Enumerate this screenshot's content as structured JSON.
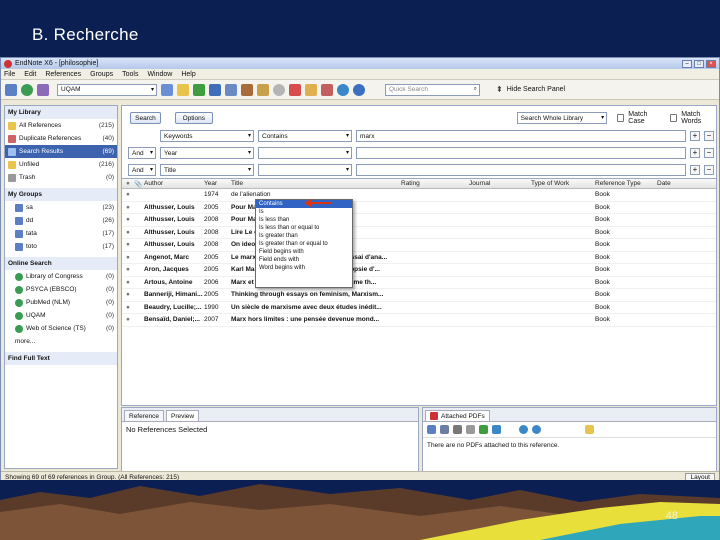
{
  "slide": {
    "title": "B.  Recherche",
    "page_number": "48"
  },
  "app": {
    "window_title": "EndNote X6 - [philosophie]",
    "menu": [
      "File",
      "Edit",
      "References",
      "Groups",
      "Tools",
      "Window",
      "Help"
    ],
    "toolbar": {
      "library_select": "UQAM",
      "quick_search_placeholder": "Quick Search",
      "hide_search_panel": "Hide Search Panel"
    }
  },
  "sidebar": {
    "my_library": "My Library",
    "items": [
      {
        "label": "All References",
        "count": "(215)"
      },
      {
        "label": "Duplicate References",
        "count": "(40)"
      },
      {
        "label": "Search Results",
        "count": "(69)"
      },
      {
        "label": "Unfiled",
        "count": "(216)"
      },
      {
        "label": "Trash",
        "count": "(0)"
      }
    ],
    "my_groups": "My Groups",
    "groups": [
      {
        "label": "sa",
        "count": "(23)"
      },
      {
        "label": "dd",
        "count": "(26)"
      },
      {
        "label": "tata",
        "count": "(17)"
      },
      {
        "label": "toto",
        "count": "(17)"
      }
    ],
    "online_search": "Online Search",
    "online": [
      {
        "label": "Library of Congress",
        "count": "(0)"
      },
      {
        "label": "PSYCA (EBSCO)",
        "count": "(0)"
      },
      {
        "label": "PubMed (NLM)",
        "count": "(0)"
      },
      {
        "label": "UQAM",
        "count": "(0)"
      },
      {
        "label": "Web of Science (TS)",
        "count": "(0)"
      }
    ],
    "more": "more...",
    "find_full_text": "Find Full Text"
  },
  "search": {
    "search_button": "Search",
    "options_button": "Options",
    "search_scope": "Search Whole Library",
    "match_case": "Match Case",
    "match_words": "Match Words",
    "rows": [
      {
        "bool": "",
        "field": "Keywords",
        "op": "Contains",
        "value": "marx"
      },
      {
        "bool": "And",
        "field": "Year",
        "op": "",
        "value": ""
      },
      {
        "bool": "And",
        "field": "Title",
        "op": "",
        "value": ""
      }
    ],
    "operators": [
      "Contains",
      "Is",
      "Is less than",
      "Is less than or equal to",
      "Is greater than",
      "Is greater than or equal to",
      "Field begins with",
      "Field ends with",
      "Word begins with"
    ]
  },
  "table": {
    "headers": [
      "Author",
      "Year",
      "Title",
      "Rating",
      "Journal",
      "Type of Work",
      "Reference Type",
      "Date"
    ],
    "rows": [
      {
        "author": "",
        "year": "1974",
        "title": "de l'alienation",
        "rt": "Book"
      },
      {
        "author": "Althusser, Louis",
        "year": "2005",
        "title": "Pour Marx",
        "rt": "Book"
      },
      {
        "author": "Althusser, Louis",
        "year": "2008",
        "title": "Pour Marx",
        "rt": "Book"
      },
      {
        "author": "Althusser, Louis",
        "year": "2008",
        "title": "Lire Le capital",
        "rt": "Book"
      },
      {
        "author": "Althusser, Louis",
        "year": "2008",
        "title": "On ideology",
        "rt": "Book"
      },
      {
        "author": "Angenot, Marc",
        "year": "2005",
        "title": "Le marxisme dans les grands récits : essai d'ana...",
        "rt": "Book"
      },
      {
        "author": "Aron, Jacques",
        "year": "2005",
        "title": "Karl Marx, antisémite et criminel? : autopsie d'...",
        "rt": "Book"
      },
      {
        "author": "Artous, Antoine",
        "year": "2006",
        "title": "Marx et le fétichisme : le marxisme comme th...",
        "rt": "Book"
      },
      {
        "author": "Banneriji, Himani...",
        "year": "2005",
        "title": "Thinking through essays on feminism, Marxism...",
        "rt": "Book"
      },
      {
        "author": "Beaudry, Lucille;...",
        "year": "1990",
        "title": "Un siècle de marxisme avec deux études inédit...",
        "rt": "Book"
      },
      {
        "author": "Bensaïd, Daniel;...",
        "year": "2007",
        "title": "Marx hors limites : une pensée devenue mond...",
        "rt": "Book"
      }
    ]
  },
  "preview": {
    "tab_reference": "Reference",
    "tab_preview": "Preview",
    "no_refs": "No References Selected"
  },
  "pdf": {
    "tab": "Attached PDFs",
    "message": "There are no PDFs attached to this reference."
  },
  "status": {
    "text": "Showing 69 of 69 references in Group. (All References: 215)",
    "layout": "Layout"
  }
}
